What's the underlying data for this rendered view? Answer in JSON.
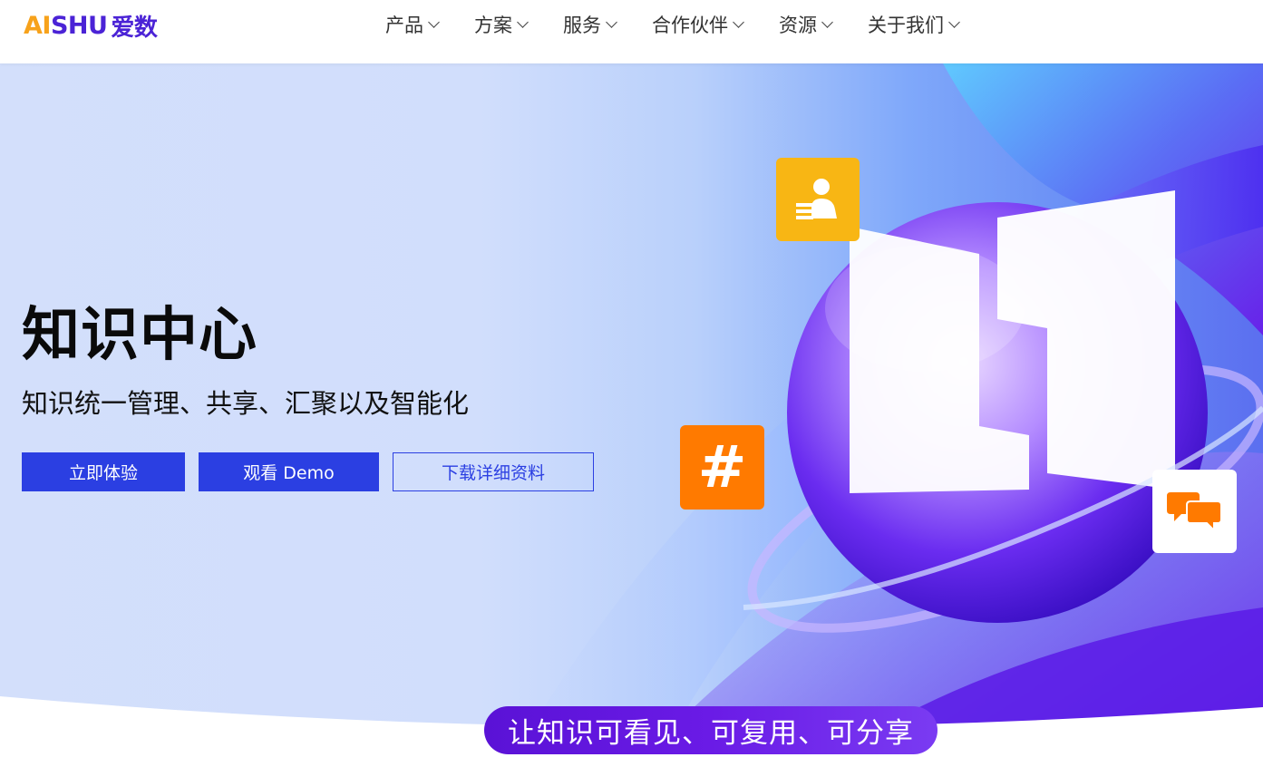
{
  "brand": {
    "logo_latin_a": "AI",
    "logo_latin_b": "SHU",
    "logo_cn": "爱数",
    "colors": {
      "orange": "#f7a21b",
      "purple": "#4b23d6"
    }
  },
  "nav": {
    "items": [
      {
        "label": "产品",
        "icon": "chevron-down-icon"
      },
      {
        "label": "方案",
        "icon": "chevron-down-icon"
      },
      {
        "label": "服务",
        "icon": "chevron-down-icon"
      },
      {
        "label": "合作伙伴",
        "icon": "chevron-down-icon"
      },
      {
        "label": "资源",
        "icon": "chevron-down-icon"
      },
      {
        "label": "关于我们",
        "icon": "chevron-down-icon"
      }
    ]
  },
  "hero": {
    "title": "知识中心",
    "subtitle": "知识统一管理、共享、汇聚以及智能化",
    "buttons": {
      "try_label": "立即体验",
      "demo_label": "观看 Demo",
      "download_label": "下载详细资料"
    },
    "tiles": {
      "user_icon": "user-profile-icon",
      "hash_symbol": "#",
      "chat_icon": "chat-bubbles-icon"
    },
    "accent_color": "#2b3fe2"
  },
  "slogan": "让知识可看见、可复用、可分享"
}
